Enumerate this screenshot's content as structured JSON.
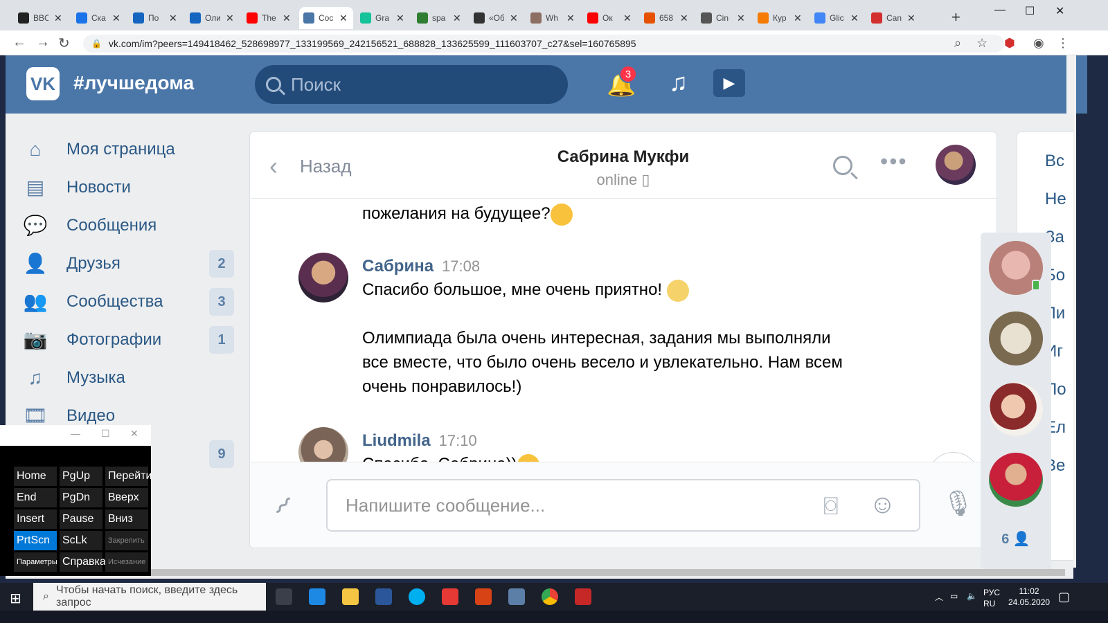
{
  "browser": {
    "tabs": [
      {
        "title": "BBC",
        "color": "#222222"
      },
      {
        "title": "Ска",
        "color": "#1a73e8"
      },
      {
        "title": "По",
        "color": "#1565c0"
      },
      {
        "title": "Оли",
        "color": "#1565c0"
      },
      {
        "title": "The",
        "color": "#ff0000"
      },
      {
        "title": "Сос",
        "color": "#4a76a8",
        "active": true
      },
      {
        "title": "Gra",
        "color": "#15c39a"
      },
      {
        "title": "spa",
        "color": "#2e7d32"
      },
      {
        "title": "«Об",
        "color": "#333333"
      },
      {
        "title": "Wh",
        "color": "#8d6e63"
      },
      {
        "title": "Ок",
        "color": "#ff0000"
      },
      {
        "title": "658",
        "color": "#e65100"
      },
      {
        "title": "Cin",
        "color": "#555555"
      },
      {
        "title": "Кур",
        "color": "#f57c00"
      },
      {
        "title": "Glic",
        "color": "#4285f4"
      },
      {
        "title": "Can",
        "color": "#d32f2f"
      }
    ],
    "url": "vk.com/im?peers=149418462_528698977_133199569_242156521_688828_133625599_111603707_c27&sel=160765895"
  },
  "vk": {
    "logo": "VK",
    "hashtag": "#лучшедома",
    "search_placeholder": "Поиск",
    "notifications": "3"
  },
  "left_nav": [
    {
      "label": "Моя страница",
      "icon": "home-icon",
      "glyph": "⌂",
      "count": ""
    },
    {
      "label": "Новости",
      "icon": "news-icon",
      "glyph": "▤",
      "count": ""
    },
    {
      "label": "Сообщения",
      "icon": "messages-icon",
      "glyph": "💬",
      "count": ""
    },
    {
      "label": "Друзья",
      "icon": "friends-icon",
      "glyph": "👤",
      "count": "2"
    },
    {
      "label": "Сообщества",
      "icon": "communities-icon",
      "glyph": "👥",
      "count": "3"
    },
    {
      "label": "Фотографии",
      "icon": "camera-icon",
      "glyph": "📷",
      "count": "1"
    },
    {
      "label": "Музыка",
      "icon": "music-icon",
      "glyph": "♫",
      "count": ""
    },
    {
      "label": "Видео",
      "icon": "video-icon",
      "glyph": "🎞",
      "count": ""
    },
    {
      "label": "",
      "icon": "",
      "glyph": "",
      "count": "9"
    }
  ],
  "chat": {
    "back_label": "Назад",
    "name": "Сабрина Мукфи",
    "status": "online",
    "messages": [
      {
        "text": "пожелания на будущее?"
      },
      {
        "author": "Сабрина",
        "time": "17:08",
        "lines": [
          "Спасибо большое, мне очень приятно!",
          "",
          "Олимпиада была очень интересная, задания мы выполняли",
          "все вместе, что было очень весело и увлекательно. Нам всем",
          "очень понравилось!)"
        ]
      },
      {
        "author": "Liudmila",
        "time": "17:10",
        "text": "Спасибо, Сабрина))"
      }
    ],
    "input_placeholder": "Напишите сообщение..."
  },
  "right_nav": [
    "Вс",
    "Не",
    "За",
    "Бо",
    "Ли",
    "Иг",
    "По",
    "Ел",
    "Ве"
  ],
  "friends_count": "6",
  "osk": {
    "keys": [
      [
        "Home",
        "PgUp",
        "Перейти"
      ],
      [
        "End",
        "PgDn",
        "Вверх"
      ],
      [
        "Insert",
        "Pause",
        "Вниз"
      ],
      [
        "PrtScn",
        "ScLk",
        "Закрепить"
      ],
      [
        "Параметры",
        "Справка",
        "Исчезание"
      ]
    ]
  },
  "taskbar": {
    "search_placeholder": "Чтобы начать поиск, введите здесь запрос",
    "lang": "РУС",
    "lang_sub": "RU",
    "time": "11:02",
    "date": "24.05.2020"
  }
}
